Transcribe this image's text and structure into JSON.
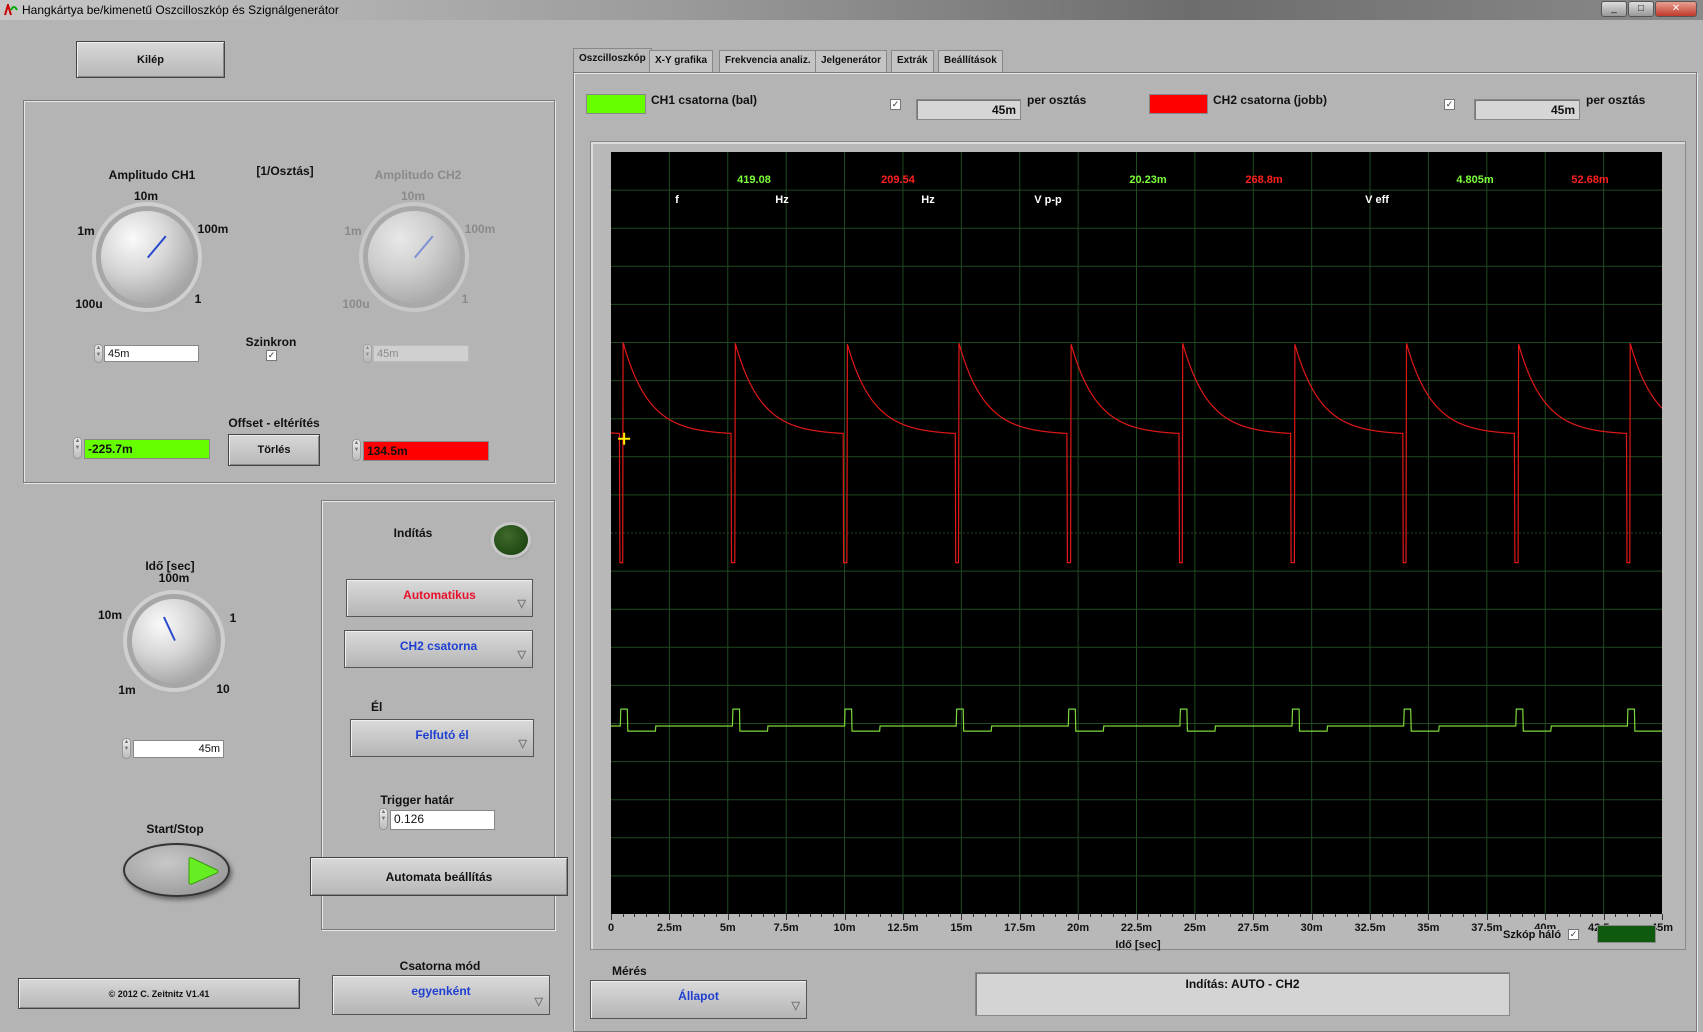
{
  "window": {
    "title": "Hangkártya be/kimenetű Oszcilloszkóp és Szignálgenerátor"
  },
  "exit_label": "Kilép",
  "amp": {
    "ch1_label": "Amplitudo CH1",
    "ch2_label": "Amplitudo CH2",
    "unit_label": "[1/Osztás]",
    "scale": [
      "10m",
      "1m",
      "100m",
      "100u",
      "1"
    ],
    "ch1_value": "45m",
    "ch2_value": "45m",
    "sync_label": "Szinkron",
    "sync_checked": true,
    "offset_label": "Offset - eltérítés",
    "offset_ch1": "-225.7m",
    "offset_ch2": "134.5m",
    "clear_label": "Törlés"
  },
  "time": {
    "label": "Idő [sec]",
    "scale": [
      "100m",
      "10m",
      "1",
      "1m",
      "10"
    ],
    "value": "45m"
  },
  "startstop_label": "Start/Stop",
  "copyright": "© 2012  C. Zeitnitz V1.41",
  "trigger": {
    "label": "Indítás",
    "mode": "Automatikus",
    "source": "CH2 csatorna",
    "edge_label": "Él",
    "edge": "Felfutó él",
    "level_label": "Trigger határ",
    "level": "0.126",
    "auto_setup": "Automata beállítás"
  },
  "channel_mode": {
    "label": "Csatorna mód",
    "value": "egyenként"
  },
  "tabs": [
    "Oszcilloszkóp",
    "X-Y grafika",
    "Frekvencia analiz.",
    "Jelgenerátor",
    "Extrák",
    "Beállítások"
  ],
  "channels": {
    "ch1_label": "CH1 csatorna (bal)",
    "ch1_scale": "45m",
    "ch2_label": "CH2 csatorna (jobb)",
    "ch2_scale": "45m",
    "per_div": "per osztás",
    "ch1_checked": true,
    "ch2_checked": true
  },
  "colors": {
    "ch1": "#66ff00",
    "ch2": "#ff0000",
    "grid": "#1f4a1f",
    "led_off": "#1e4a14",
    "ch1_trace": "#7cd83a",
    "ch2_trace": "#e01818"
  },
  "measure": {
    "f_label": "f",
    "hz1": "Hz",
    "hz2": "Hz",
    "vpp_label": "V p-p",
    "veff_label": "V eff",
    "f_ch1": "419.08",
    "f_ch2": "209.54",
    "vpp_ch1": "20.23m",
    "vpp_ch2": "268.8m",
    "veff_ch1": "4.805m",
    "veff_ch2": "52.68m"
  },
  "grid_label": "Szkóp háló",
  "grid_checked": true,
  "meres": {
    "label": "Mérés",
    "value": "Állapot"
  },
  "status": "Indítás: AUTO - CH2",
  "chart_data": {
    "type": "line",
    "xlabel": "Idő [sec]",
    "xlim": [
      0,
      0.045
    ],
    "xticks": [
      "0",
      "2.5m",
      "5m",
      "7.5m",
      "10m",
      "12.5m",
      "15m",
      "17.5m",
      "20m",
      "22.5m",
      "25m",
      "27.5m",
      "30m",
      "32.5m",
      "35m",
      "37.5m",
      "40m",
      "42.5m",
      "45m"
    ],
    "x_divisions": 18,
    "y_divisions": 20,
    "volts_per_div": 0.045,
    "grid": true,
    "series": [
      {
        "channel": "CH2",
        "color": "#e01818",
        "period_s": 0.00479,
        "first_edge_s": 0.00052,
        "peak_V": 0.225,
        "settle_V": 0.116,
        "min_V": -0.035,
        "decay_tau_s": 0.0011
      },
      {
        "channel": "CH1",
        "color": "#7cd83a",
        "period_s": 0.00479,
        "first_edge_s": 0.00052,
        "base_V": -0.228,
        "pulse_V": -0.208,
        "dip_V": -0.234,
        "pulse_width_s": 0.0003
      }
    ]
  }
}
